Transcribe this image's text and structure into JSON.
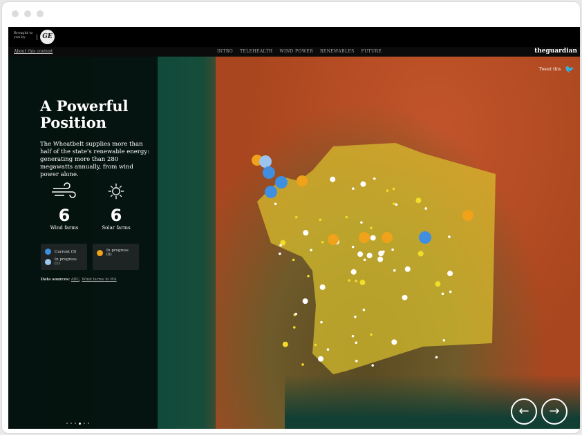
{
  "header": {
    "brought_by": "Brought to you by",
    "sponsor": "GE",
    "about": "About this content",
    "nav": [
      "INTRO",
      "TELEHEALTH",
      "WIND POWER",
      "RENEWABLES",
      "FUTURE"
    ],
    "publisher": "theguardian",
    "tweet": "Tweet this"
  },
  "panel": {
    "title": "A Powerful Position",
    "intro": "The Wheatbelt supplies more than half of the state's renewable energy: generating more than 280 megawatts annually, from wind power alone.",
    "wind": {
      "count": "6",
      "label": "Wind farms"
    },
    "solar": {
      "count": "6",
      "label": "Solar farms"
    },
    "legend_wind": [
      {
        "label": "Current (5)",
        "color": "#3f8ee0"
      },
      {
        "label": "In progress (1)",
        "color": "#9cc4ee"
      }
    ],
    "legend_solar": [
      {
        "label": "In progress (6)",
        "color": "#f0a21a"
      }
    ],
    "sources_label": "Data sources:",
    "sources": [
      "ABC",
      "Wind farms in WA"
    ]
  },
  "colors": {
    "region": "#d9c12e",
    "town": "#f2dc2a"
  }
}
